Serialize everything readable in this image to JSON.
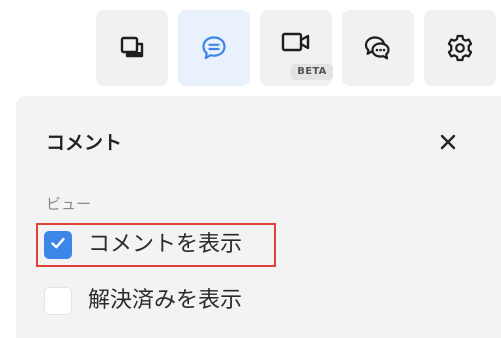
{
  "toolbar": {
    "buttons": [
      {
        "icon": "copy-icon"
      },
      {
        "icon": "comment-icon",
        "active": true,
        "accent": "#3c86e8"
      },
      {
        "icon": "video-icon",
        "badge": "BETA"
      },
      {
        "icon": "chat-bubbles-icon"
      },
      {
        "icon": "gear-icon"
      }
    ]
  },
  "panel": {
    "title": "コメント",
    "close_icon": "close-icon",
    "section_label": "ビュー",
    "options": [
      {
        "label": "コメントを表示",
        "checked": true
      },
      {
        "label": "解決済みを表示",
        "checked": false
      }
    ]
  },
  "colors": {
    "accent": "#3c86e8",
    "highlight_border": "#e0413a",
    "panel_background": "#f3f3f3",
    "toolbar_button_background": "#f1f1f1"
  }
}
